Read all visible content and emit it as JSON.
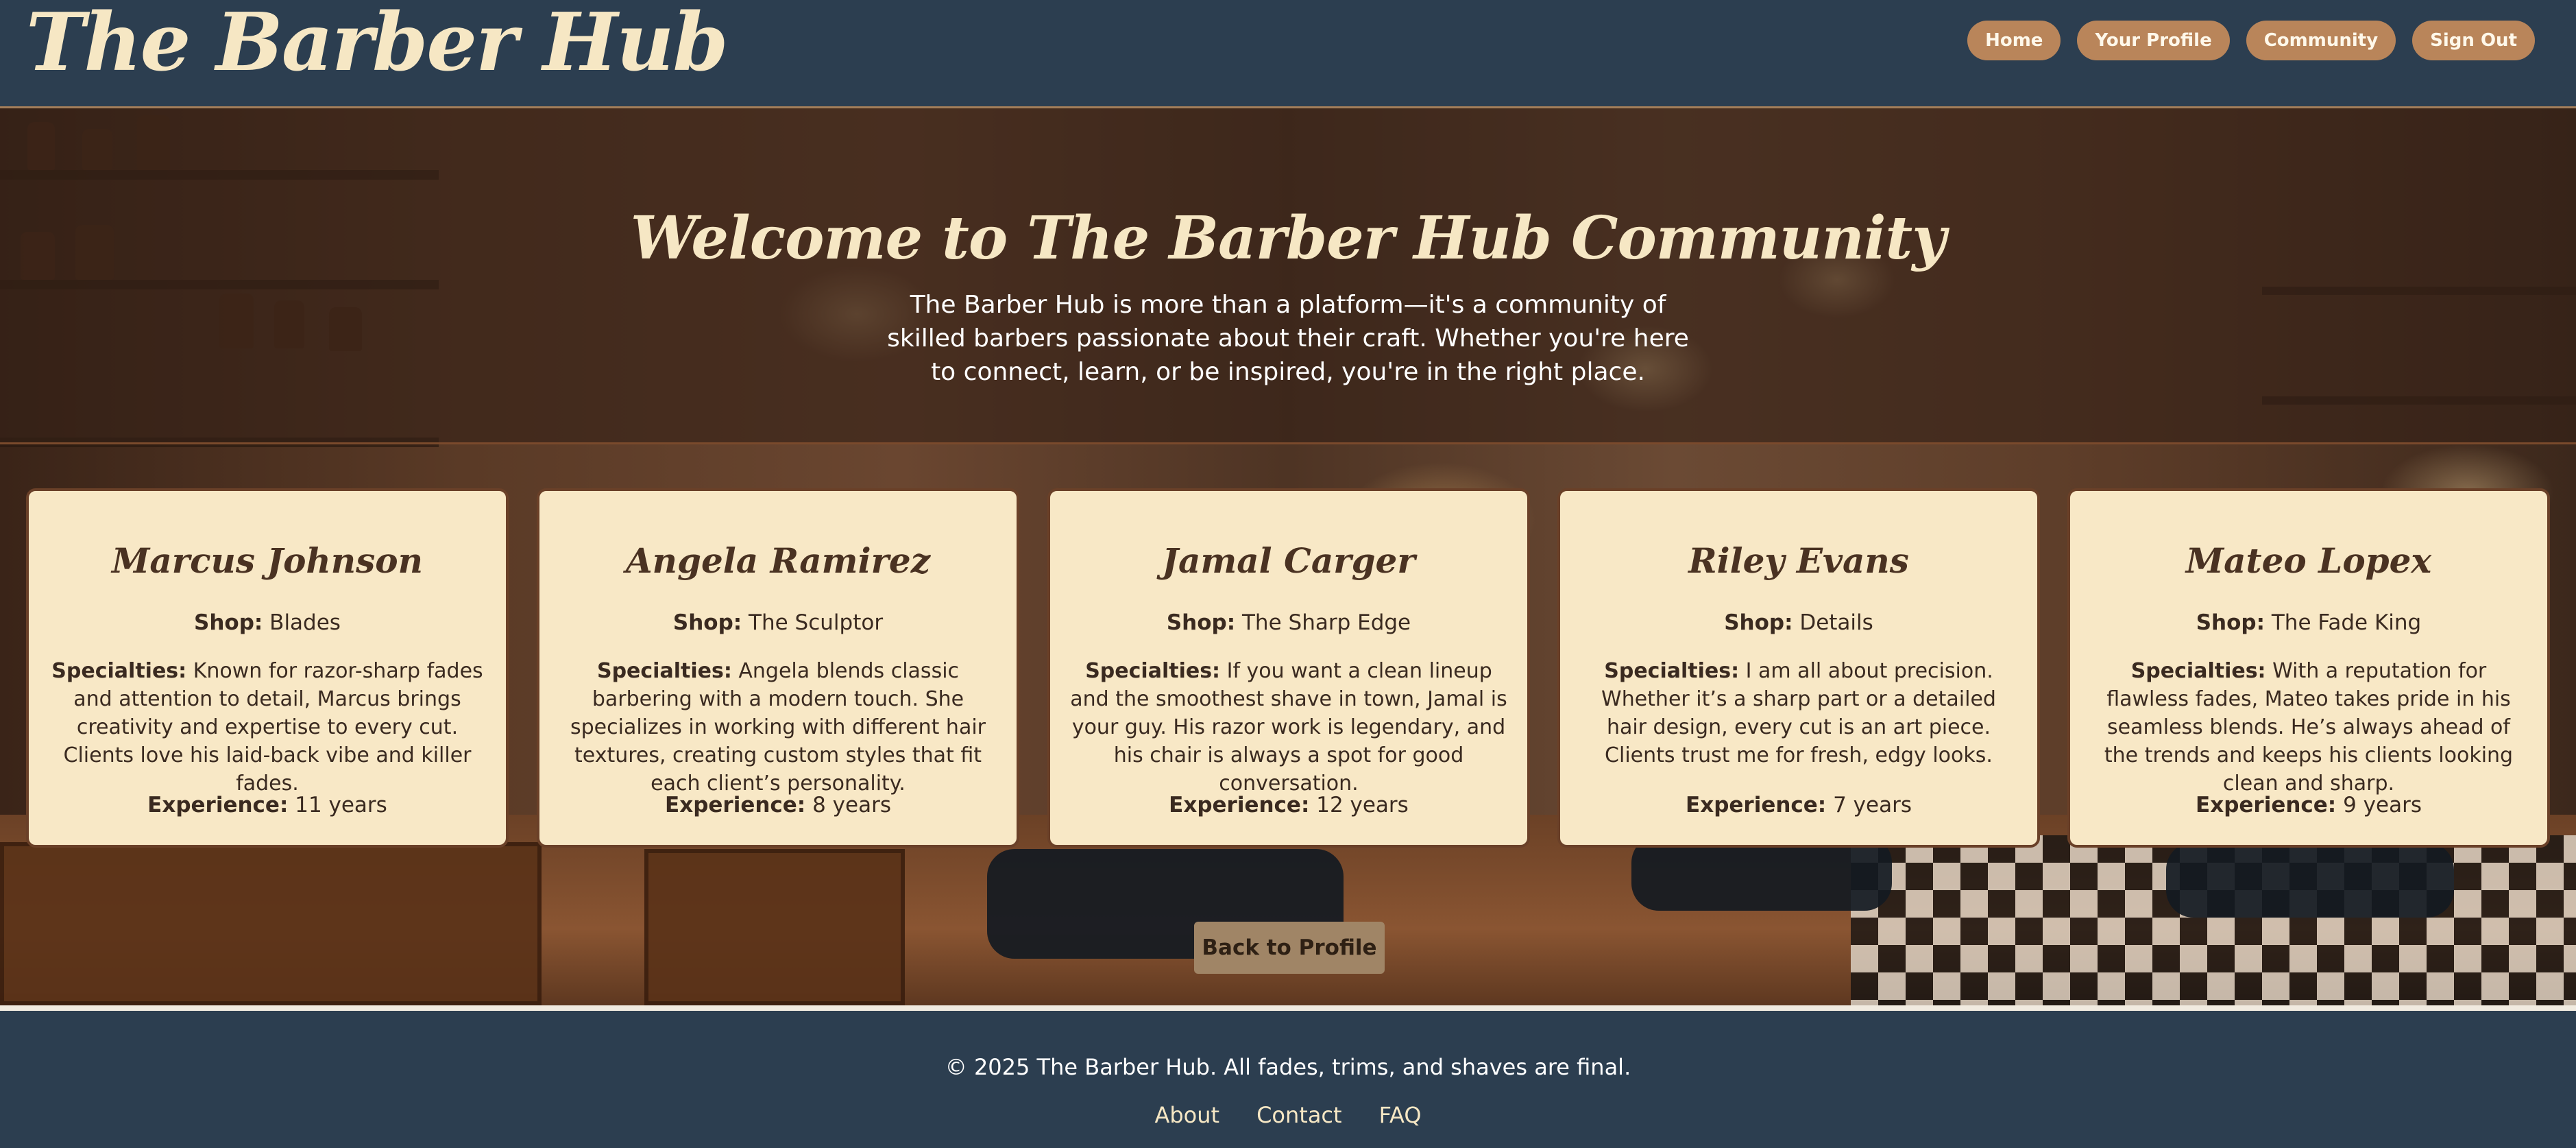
{
  "header": {
    "logo": "The Barber Hub",
    "nav": [
      "Home",
      "Your Profile",
      "Community",
      "Sign Out"
    ]
  },
  "hero": {
    "title": "Welcome to The Barber Hub Community",
    "description": "The Barber Hub is more than a platform—it's a community of skilled barbers passionate about their craft. Whether you're here to connect, learn, or be inspired, you're in the right place."
  },
  "labels": {
    "shop": "Shop:",
    "specialties": "Specialties:",
    "experience": "Experience:"
  },
  "barbers": [
    {
      "name": "Marcus Johnson",
      "shop": "Blades",
      "specialties": "Known for razor-sharp fades and attention to detail, Marcus brings creativity and expertise to every cut. Clients love his laid-back vibe and killer fades.",
      "experience": "11 years"
    },
    {
      "name": "Angela Ramirez",
      "shop": "The Sculptor",
      "specialties": "Angela blends classic barbering with a modern touch. She specializes in working with different hair textures, creating custom styles that fit each client’s personality.",
      "experience": "8 years"
    },
    {
      "name": "Jamal Carger",
      "shop": "The Sharp Edge",
      "specialties": "If you want a clean lineup and the smoothest shave in town, Jamal is your guy. His razor work is legendary, and his chair is always a spot for good conversation.",
      "experience": "12 years"
    },
    {
      "name": "Riley Evans",
      "shop": "Details",
      "specialties": "I am all about precision. Whether it’s a sharp part or a detailed hair design, every cut is an art piece. Clients trust me for fresh, edgy looks.",
      "experience": "7 years"
    },
    {
      "name": "Mateo Lopex",
      "shop": "The Fade King",
      "specialties": "With a reputation for flawless fades, Mateo takes pride in his seamless blends. He’s always ahead of the trends and keeps his clients looking clean and sharp.",
      "experience": "9 years"
    }
  ],
  "back_button": "Back to Profile",
  "footer": {
    "copyright": "© 2025 The Barber Hub. All fades, trims, and shaves are final.",
    "links": [
      "About",
      "Contact",
      "FAQ"
    ]
  },
  "colors": {
    "navy": "#2c3e50",
    "cream": "#f6e7c4",
    "accent": "#b9855a",
    "card_bg": "#f8e8c6"
  }
}
